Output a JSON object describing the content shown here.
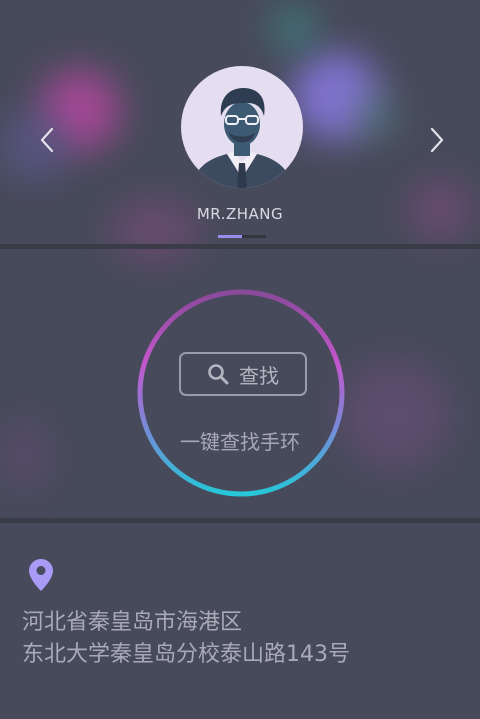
{
  "profile": {
    "name": "MR.ZHANG",
    "prev_icon": "chevron-left-icon",
    "next_icon": "chevron-right-icon",
    "page_index": 1,
    "page_count": 2
  },
  "finder": {
    "button_label": "查找",
    "button_icon": "search-icon",
    "description": "一键查找手环"
  },
  "location": {
    "icon": "location-pin-icon",
    "line1": "河北省秦皇岛市海港区",
    "line2": "东北大学秦皇岛分校泰山路143号"
  },
  "colors": {
    "accent": "#9b8cf0",
    "ring_top": "#c055c8",
    "ring_bottom": "#2ec3d6",
    "pin": "#a99af5",
    "background": "#474a5a"
  }
}
